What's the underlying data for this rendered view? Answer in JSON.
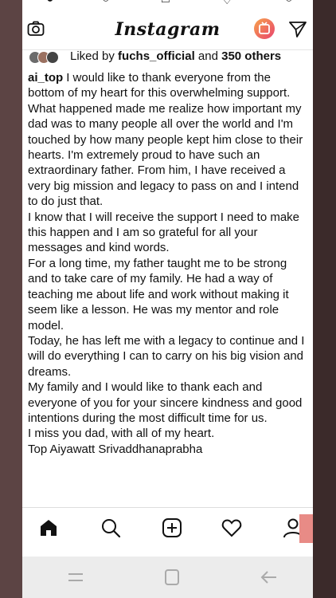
{
  "header": {
    "logo_text": "Instagram",
    "icons": [
      "camera-icon",
      "igtv-icon",
      "direct-send-icon"
    ]
  },
  "likes": {
    "prefix": "Liked by ",
    "user": "fuchs_official",
    "middle": " and ",
    "others": "350 others"
  },
  "caption": {
    "username": "ai_top",
    "paragraphs": [
      "I would like to thank everyone from the bottom of my heart for this overwhelming support. What happened made me realize how important my dad was to many people all over the world and I'm touched by how many people kept him close to their hearts. I'm extremely proud to have such an extraordinary father. From him, I have received a very big mission and legacy to pass on and I intend to do just that.",
      "I know that I will receive the support I need to make this happen and I am so grateful for all your messages and kind words.",
      "For a long time, my father taught me to be strong and to take care of my family. He had a way of teaching me about life and work without making it seem like a lesson. He was my mentor and role model.",
      "Today, he has left me with a legacy to continue and I will do everything I can to carry on his big vision and dreams.",
      "My family and I would like to thank each and everyone of you for your sincere kindness and good intentions during the most difficult time for us.",
      "I miss you dad, with all of my heart.",
      "Top Aiyawatt Srivaddhanaprabha"
    ]
  },
  "bottom_nav": {
    "items": [
      "home-icon",
      "search-icon",
      "new-post-icon",
      "activity-heart-icon",
      "profile-icon"
    ]
  },
  "system_nav": {
    "items": [
      "recents-icon",
      "home-square-icon",
      "back-icon"
    ]
  },
  "colors": {
    "frame_left": "#5c4444",
    "frame_right": "#3b2a2a",
    "text": "#111111",
    "igtv_gradient_start": "#f7a34b",
    "igtv_gradient_end": "#e8436e"
  }
}
